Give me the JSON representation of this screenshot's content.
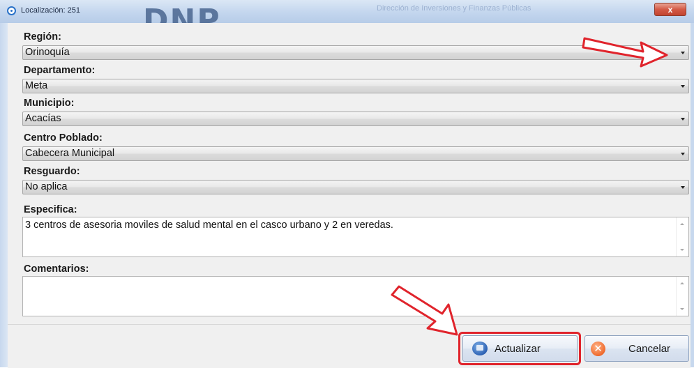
{
  "window": {
    "title": "Localización: 251",
    "logo": "DNP",
    "watermark": "Dirección de Inversiones y Finanzas Públicas",
    "close_symbol": "x"
  },
  "form": {
    "fields": [
      {
        "label": "Región:",
        "value": "Orinoquía"
      },
      {
        "label": "Departamento:",
        "value": "Meta"
      },
      {
        "label": "Municipio:",
        "value": "Acacías"
      },
      {
        "label": "Centro Poblado:",
        "value": "Cabecera Municipal"
      },
      {
        "label": "Resguardo:",
        "value": "No aplica"
      }
    ],
    "especifica": {
      "label": "Especifica:",
      "value": "3 centros  de asesoria moviles de salud mental en el casco urbano y 2 en veredas."
    },
    "comentarios": {
      "label": "Comentarios:",
      "value": ""
    }
  },
  "buttons": {
    "actualizar": "Actualizar",
    "cancelar": "Cancelar",
    "cancel_icon": "✕"
  },
  "annotations": {
    "color": "#e0242c",
    "arrows": [
      "points to Región dropdown",
      "points to Actualizar button"
    ]
  }
}
